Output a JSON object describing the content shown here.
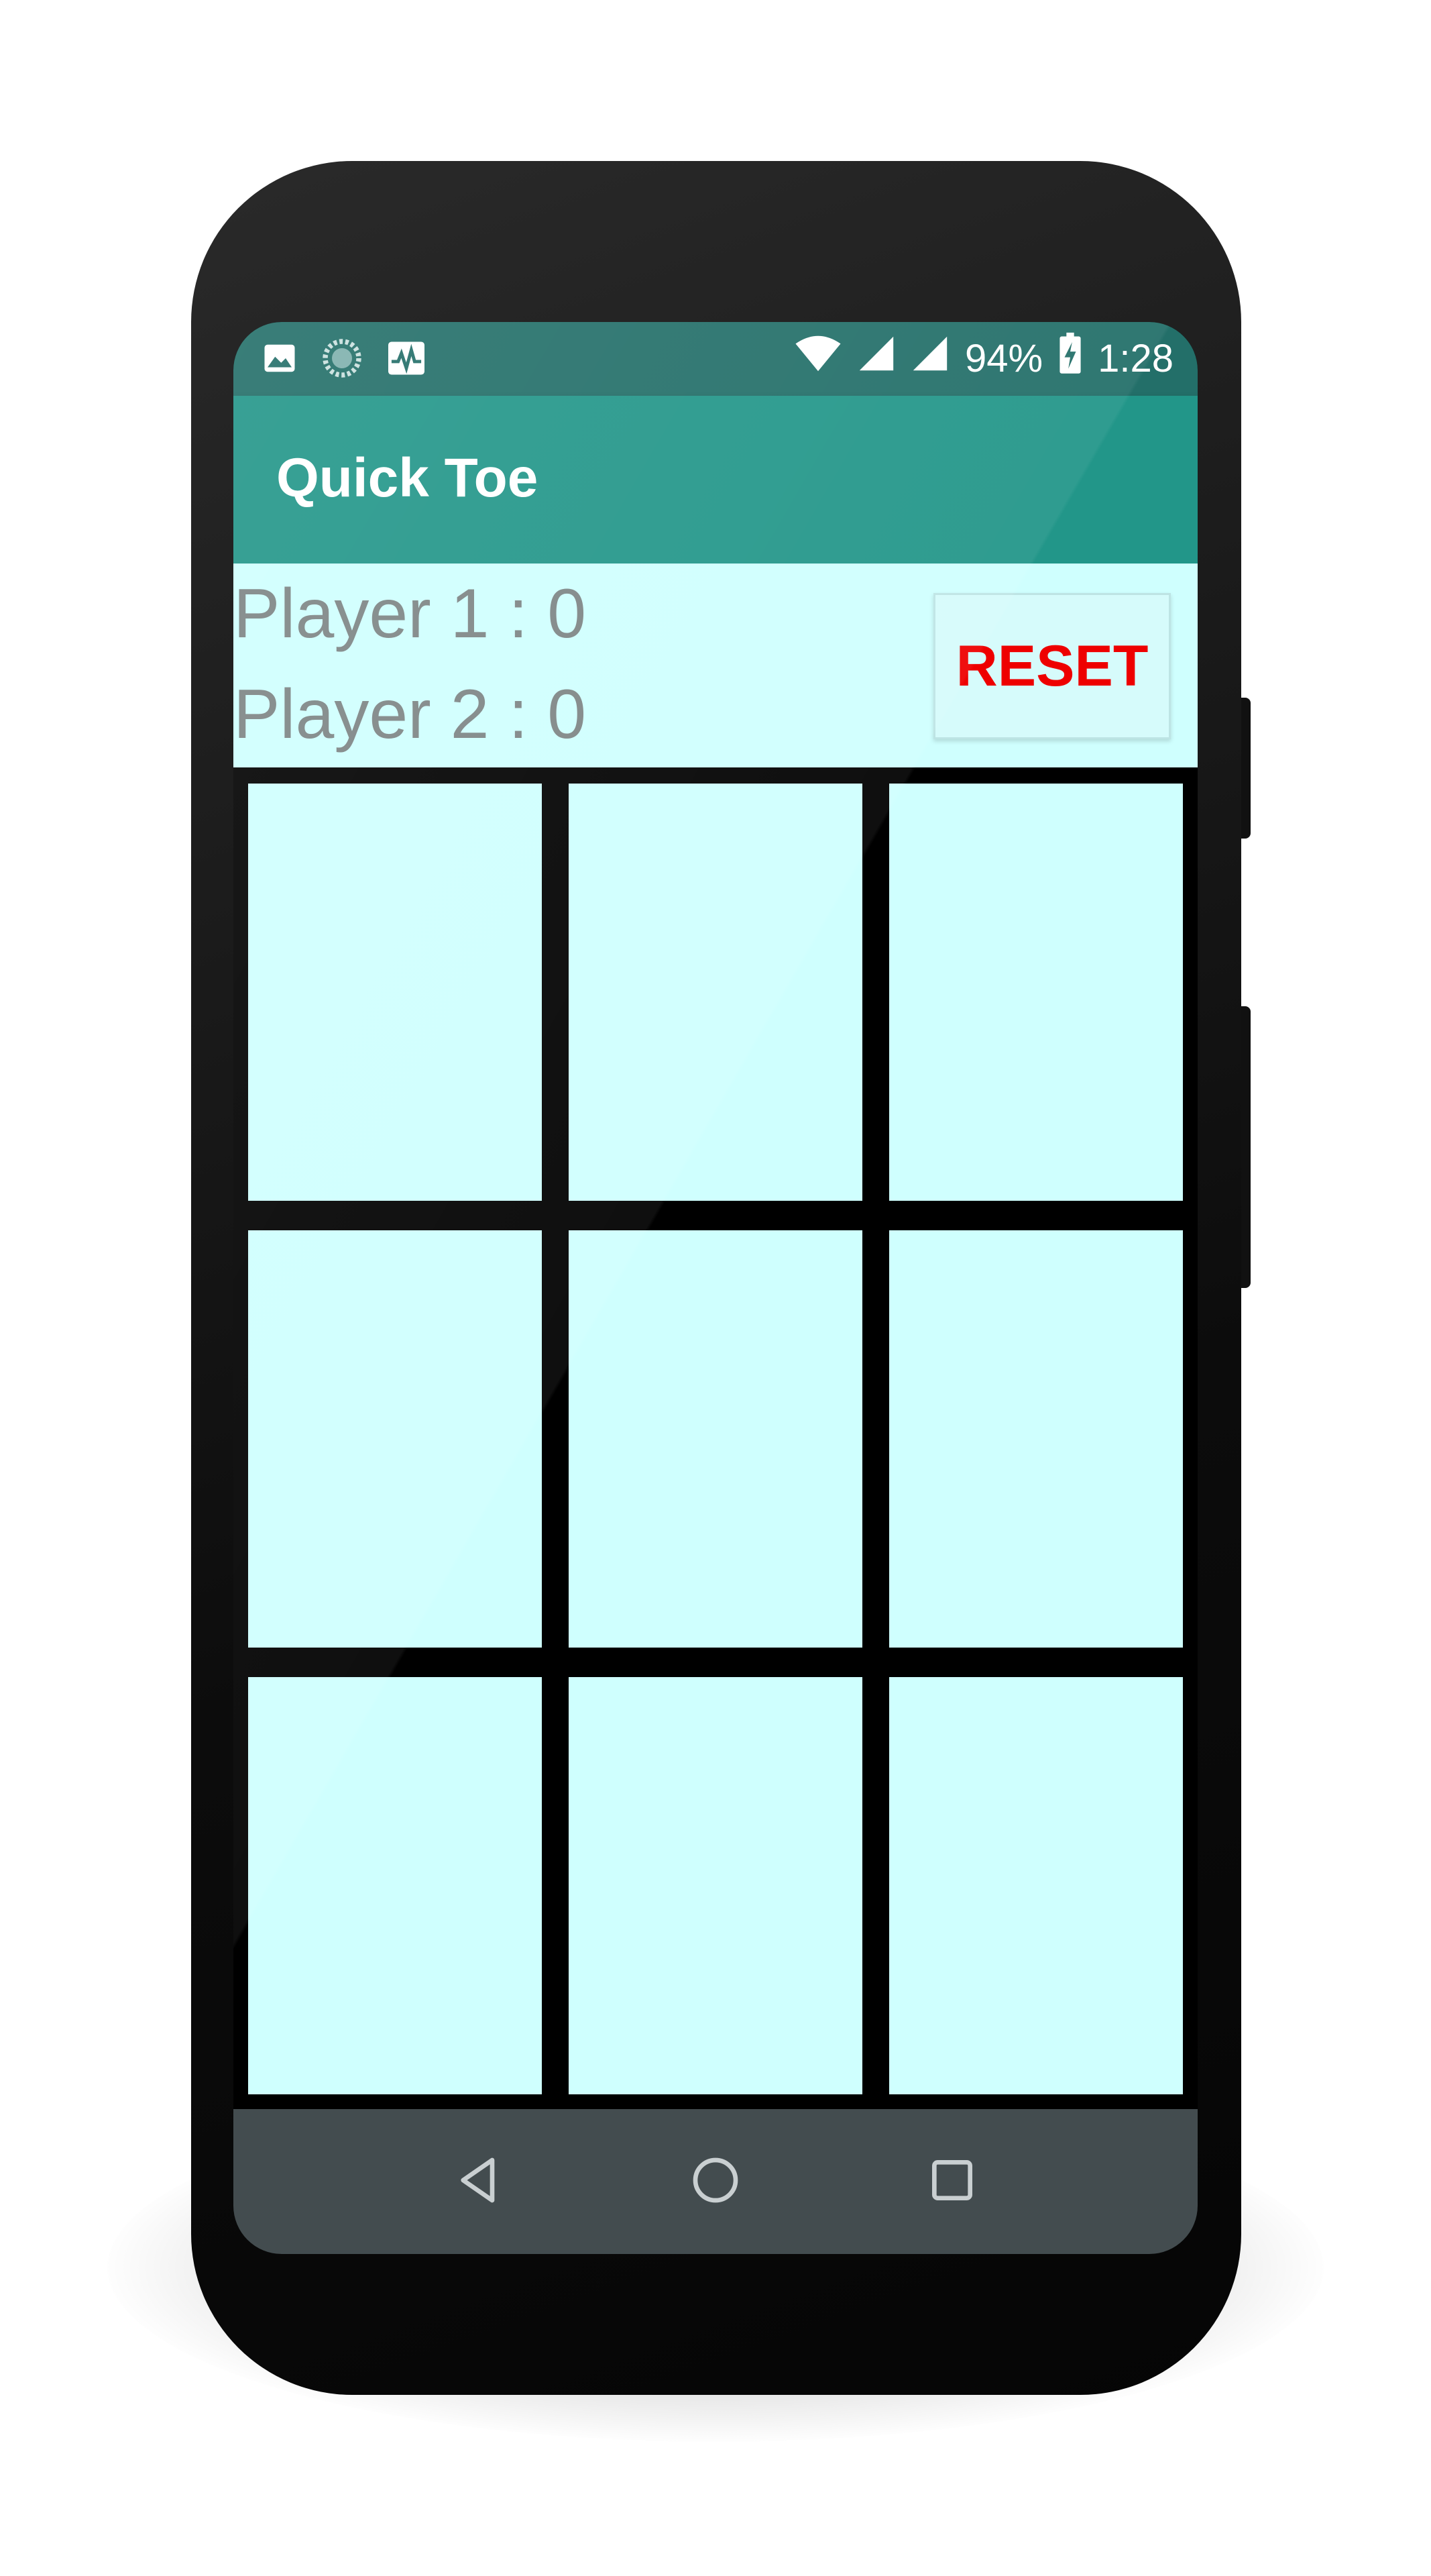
{
  "status_bar": {
    "battery": "94%",
    "time": "1:28"
  },
  "app_bar": {
    "title": "Quick Toe"
  },
  "scores": {
    "player1": "Player 1 : 0",
    "player2": "Player 2 : 0"
  },
  "reset_label": "RESET",
  "board": {
    "cells": [
      "",
      "",
      "",
      "",
      "",
      "",
      "",
      "",
      ""
    ]
  },
  "colors": {
    "status_bar": "#236f69",
    "app_bar": "#229689",
    "content_background": "#cffffe",
    "score_text": "#7d8585",
    "reset_text": "#ee0000",
    "grid_lines": "#000000",
    "nav_bar": "#434c4f"
  },
  "icons": {
    "status_left": [
      "image-icon",
      "sync-icon",
      "activity-icon"
    ],
    "status_right": [
      "wifi-icon",
      "signal-icon",
      "signal-icon",
      "battery-charging-icon"
    ],
    "nav": [
      "back-icon",
      "home-icon",
      "recents-icon"
    ]
  }
}
